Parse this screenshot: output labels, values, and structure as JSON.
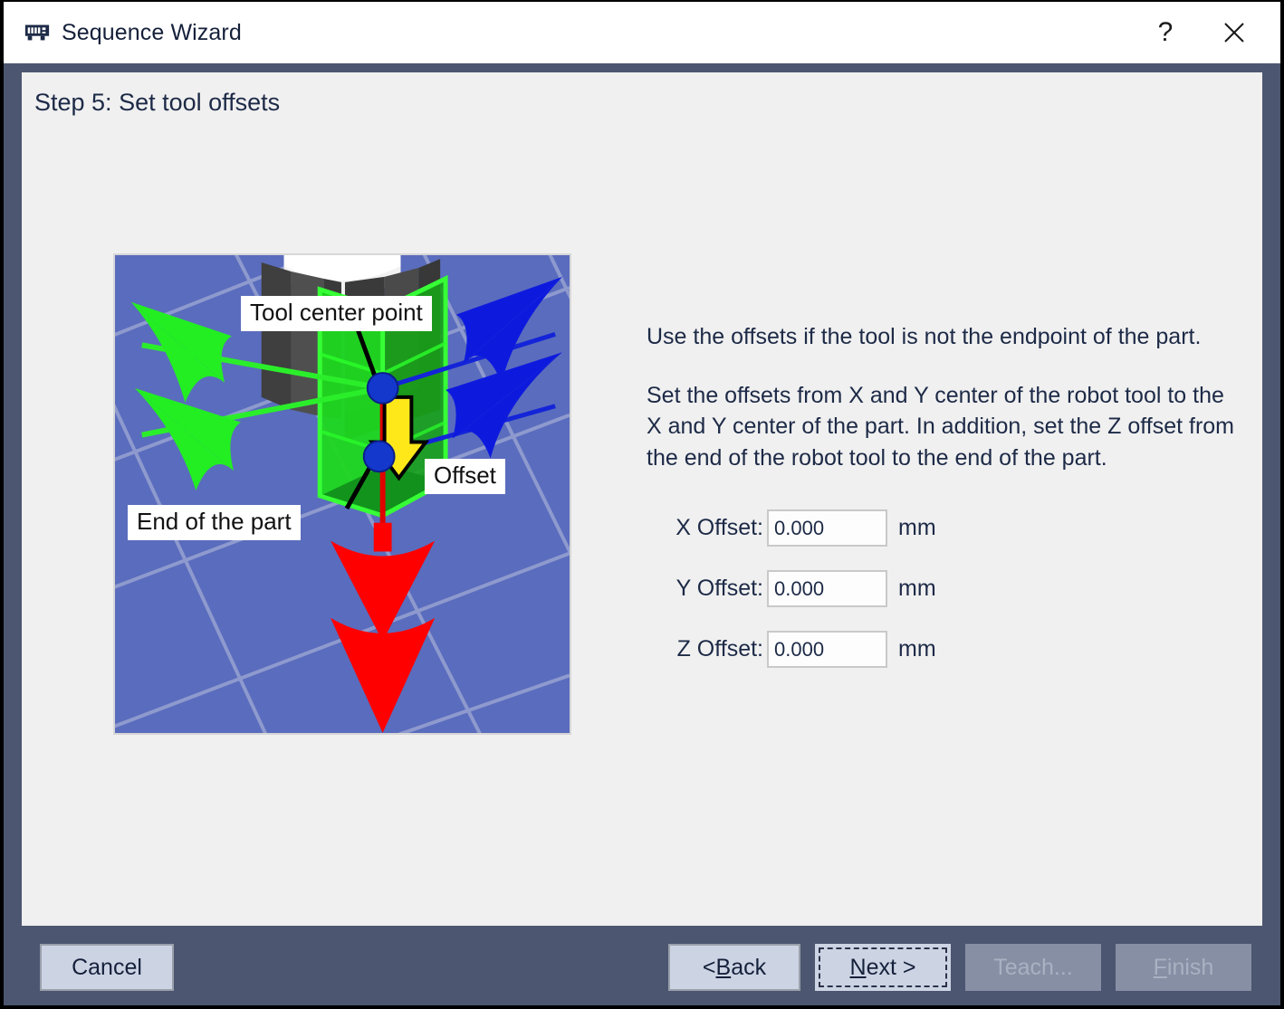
{
  "window": {
    "title": "Sequence Wizard",
    "icon": "memory-chip-icon",
    "help_label": "?",
    "close_label": "✕"
  },
  "step": {
    "title": "Step 5: Set tool offsets"
  },
  "illustration": {
    "alt": "3d-robot-tool-offset-diagram",
    "background_color": "#5a6cbd",
    "callouts": [
      {
        "id": "tool-center-point",
        "label": "Tool center point"
      },
      {
        "id": "offset",
        "label": "Offset"
      },
      {
        "id": "end-of-the-part",
        "label": "End of the part"
      }
    ],
    "axis_colors": {
      "x_axis": "#0a1ae0",
      "y_axis": "#22e022",
      "z_axis": "#ff0000",
      "offset_arrow": "#ffe81a",
      "part": "#1ad21a",
      "tool": "#4a4a4a",
      "marker": "#1438cc"
    }
  },
  "instructions": {
    "paragraph1": "Use the offsets if the tool is not the endpoint of the part.",
    "paragraph2": "Set the offsets from X and Y center of the robot tool to the X and Y center of the part.  In addition, set the Z offset from the end of the robot tool to the end of the part."
  },
  "offsets": {
    "unit": "mm",
    "fields": [
      {
        "id": "x-offset",
        "label": "X Offset:",
        "value": "0.000",
        "placeholder": "0.000"
      },
      {
        "id": "y-offset",
        "label": "Y Offset:",
        "value": "0.000",
        "placeholder": "0.000"
      },
      {
        "id": "z-offset",
        "label": "Z Offset:",
        "value": "0.000",
        "placeholder": "0.000"
      }
    ]
  },
  "footer": {
    "cancel": "Cancel",
    "back_prefix": "< ",
    "back_accel": "B",
    "back_rest": "ack",
    "next_accel": "N",
    "next_rest": "ext >",
    "teach": "Teach...",
    "finish_accel": "F",
    "finish_rest": "inish"
  },
  "colors": {
    "titlebar_bg": "#ffffff",
    "frame_bg": "#4c5670",
    "content_bg": "#f0f0f0",
    "text": "#1d2a47",
    "button_bg": "#ccd4e4",
    "button_disabled_bg": "#868fa4"
  }
}
